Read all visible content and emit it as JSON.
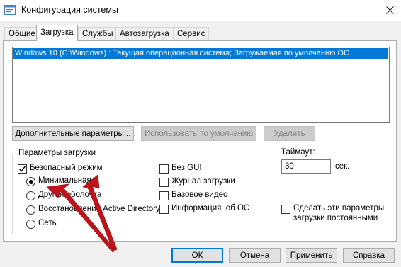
{
  "window": {
    "title": "Конфигурация системы"
  },
  "tabs": [
    "Общие",
    "Загрузка",
    "Службы",
    "Автозагрузка",
    "Сервис"
  ],
  "active_tab": "Загрузка",
  "boot_list": {
    "items": [
      "Windows 10 (C:\\Windows) : Текущая операционная система; Загружаемая по умолчанию ОС"
    ],
    "selected_index": 0
  },
  "list_buttons": {
    "advanced": "Дополнительные параметры...",
    "set_default": "Использовать по умолчанию",
    "delete": "Удалить"
  },
  "boot_options": {
    "title": "Параметры загрузки",
    "safe_boot": {
      "label": "Безопасный режим",
      "checked": true
    },
    "radios": [
      {
        "label": "Минимальная",
        "selected": true
      },
      {
        "label": "Другая оболочка",
        "selected": false
      },
      {
        "label": "Восстановление Active Directory",
        "selected": false
      },
      {
        "label": "Сеть",
        "selected": false
      }
    ],
    "checkboxes": [
      {
        "label": "Без GUI",
        "checked": false
      },
      {
        "label": "Журнал загрузки",
        "checked": false
      },
      {
        "label": "Базовое видео",
        "checked": false
      },
      {
        "label": "Информация  об ОС",
        "checked": false
      }
    ]
  },
  "timeout": {
    "label": "Таймаут:",
    "value": "30",
    "unit": "сек."
  },
  "make_permanent": {
    "label_line1": "Сделать эти параметры",
    "label_line2": "загрузки постоянными",
    "checked": false
  },
  "dialog_buttons": {
    "ok": "ОК",
    "cancel": "Отмена",
    "apply": "Применить",
    "help": "Справка"
  },
  "colors": {
    "selection": "#0078d7",
    "annotation_arrow": "#c0141a",
    "window_bg": "#f0f0f0"
  },
  "icons": {
    "app": "msconfig-window-icon",
    "close": "close-icon"
  }
}
